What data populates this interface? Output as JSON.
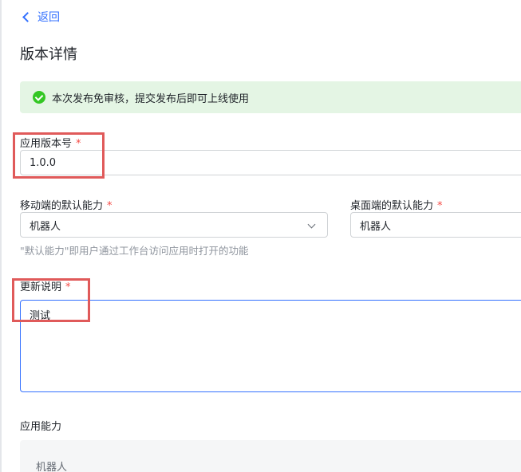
{
  "nav": {
    "back_label": "返回"
  },
  "page_title": "版本详情",
  "notice": {
    "text": "本次发布免审核，提交发布后即可上线使用"
  },
  "form": {
    "version": {
      "label": "应用版本号",
      "required_mark": "*",
      "value": "1.0.0"
    },
    "mobile_default": {
      "label": "移动端的默认能力",
      "required_mark": "*",
      "value": "机器人"
    },
    "desktop_default": {
      "label": "桌面端的默认能力",
      "required_mark": "*",
      "value": "机器人"
    },
    "default_hint": "\"默认能力\"即用户通过工作台访问应用时打开的功能",
    "release_notes": {
      "label": "更新说明",
      "required_mark": "*",
      "value": "测试"
    }
  },
  "capabilities": {
    "title": "应用能力",
    "items": [
      "机器人"
    ]
  },
  "colors": {
    "accent": "#3370ff",
    "success": "#34c724",
    "notice_bg": "#e4f5e4",
    "required": "#f54a45",
    "highlight": "#e05a5a"
  }
}
